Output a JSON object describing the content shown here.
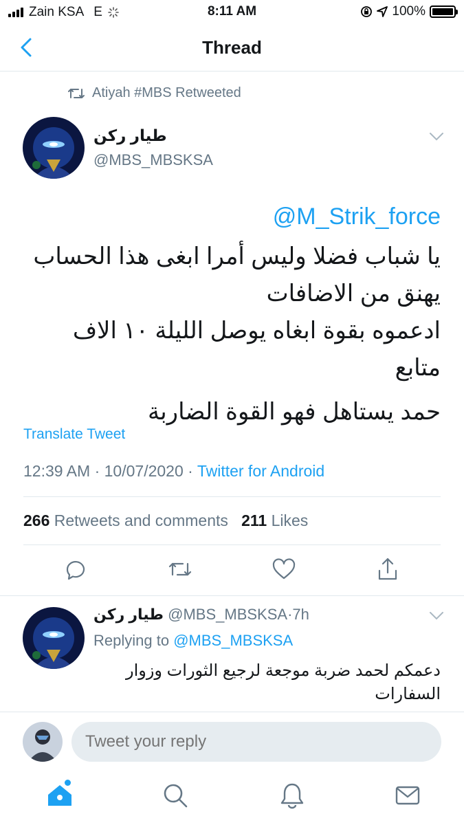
{
  "status_bar": {
    "carrier": "Zain KSA",
    "network": "E",
    "time": "8:11 AM",
    "battery": "100%",
    "icons": [
      "signal-icon",
      "loading-icon",
      "lock-rotation-icon",
      "location-icon",
      "battery-icon"
    ]
  },
  "nav": {
    "title": "Thread",
    "back_icon": "chevron-left-icon"
  },
  "retweet_context": {
    "text": "Atiyah #MBS Retweeted",
    "icon": "retweet-icon"
  },
  "tweet": {
    "name": "طيار ركن",
    "handle": "@MBS_MBSKSA",
    "mention": "@M_Strik_force",
    "lines": [
      "يا شباب فضلا وليس أمرا ابغى هذا الحساب",
      "يهنق من الاضافات",
      "ادعموه بقوة ابغاه يوصل الليلة ١٠ الاف متابع",
      "حمد يستاهل فهو القوة الضاربة"
    ],
    "translate": "Translate Tweet",
    "time": "12:39 AM",
    "date": "10/07/2020",
    "separator": "·",
    "source": "Twitter for Android",
    "retweets_count": "266",
    "retweets_label": "Retweets and comments",
    "likes_count": "211",
    "likes_label": "Likes"
  },
  "actions": [
    "comment-icon",
    "retweet-icon",
    "like-icon",
    "share-icon"
  ],
  "reply": {
    "name": "طيار ركن",
    "handle": "@MBS_MBSKSA",
    "separator": "·",
    "age": "7h",
    "replying_label": "Replying to",
    "replying_handle": "@MBS_MBSKSA",
    "text": "دعمكم لحمد ضربة موجعة لرجيع الثورات وزوار السفارات"
  },
  "composer": {
    "placeholder": "Tweet your reply"
  },
  "tabbar": [
    "home-icon",
    "search-icon",
    "notifications-icon",
    "messages-icon"
  ],
  "colors": {
    "accent": "#1da1f2",
    "secondary_text": "#657786",
    "divider": "#e1e8ed"
  }
}
